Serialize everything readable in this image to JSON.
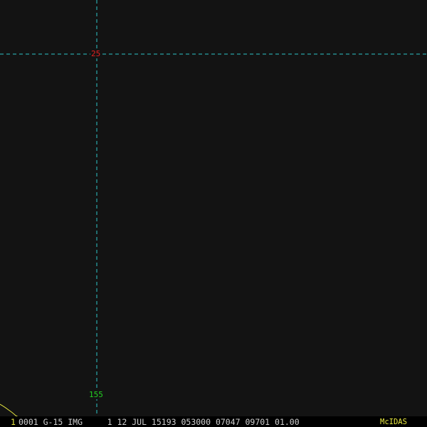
{
  "grid": {
    "latitude_label": "25",
    "longitude_label": "155",
    "line_color": "#2ec4c8",
    "latitude_label_color": "#e02020",
    "longitude_label_color": "#22d022"
  },
  "coastline": {
    "color": "#e8e840"
  },
  "status": {
    "frame_number": "1",
    "info": "0001 G-15 IMG     1 12 JUL 15193 053000 07047 09701 01.00",
    "brand": "McIDAS",
    "text_color": "#cfcfcf",
    "accent_color": "#e8e840"
  }
}
